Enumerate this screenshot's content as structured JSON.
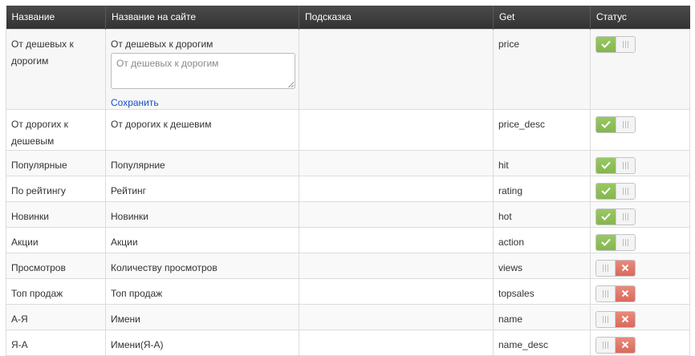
{
  "headers": {
    "name": "Название",
    "site_name": "Название на сайте",
    "hint": "Подсказка",
    "get": "Get",
    "status": "Статус"
  },
  "editing": {
    "textarea_placeholder": "От дешевых к дорогим",
    "save_label": "Сохранить"
  },
  "colors": {
    "header_bg": "#3b3b3b",
    "toggle_on": "#8fc15a",
    "toggle_off": "#e07a6c",
    "link": "#1a4fc8"
  },
  "rows": [
    {
      "name": "От дешевых к дорогим",
      "site_name": "От дешевых к дорогим",
      "hint": "",
      "get": "price",
      "status": "on"
    },
    {
      "name": "От дорогих к дешевым",
      "site_name": "От дорогих к дешевим",
      "hint": "",
      "get": "price_desc",
      "status": "on"
    },
    {
      "name": "Популярные",
      "site_name": "Популярние",
      "hint": "",
      "get": "hit",
      "status": "on"
    },
    {
      "name": "По рейтингу",
      "site_name": "Рейтинг",
      "hint": "",
      "get": "rating",
      "status": "on"
    },
    {
      "name": "Новинки",
      "site_name": "Новинки",
      "hint": "",
      "get": "hot",
      "status": "on"
    },
    {
      "name": "Акции",
      "site_name": "Акции",
      "hint": "",
      "get": "action",
      "status": "on"
    },
    {
      "name": "Просмотров",
      "site_name": "Количеству просмотров",
      "hint": "",
      "get": "views",
      "status": "off"
    },
    {
      "name": "Топ продаж",
      "site_name": "Топ продаж",
      "hint": "",
      "get": "topsales",
      "status": "off"
    },
    {
      "name": "А-Я",
      "site_name": "Имени",
      "hint": "",
      "get": "name",
      "status": "off"
    },
    {
      "name": "Я-А",
      "site_name": "Имени(Я-А)",
      "hint": "",
      "get": "name_desc",
      "status": "off"
    }
  ]
}
